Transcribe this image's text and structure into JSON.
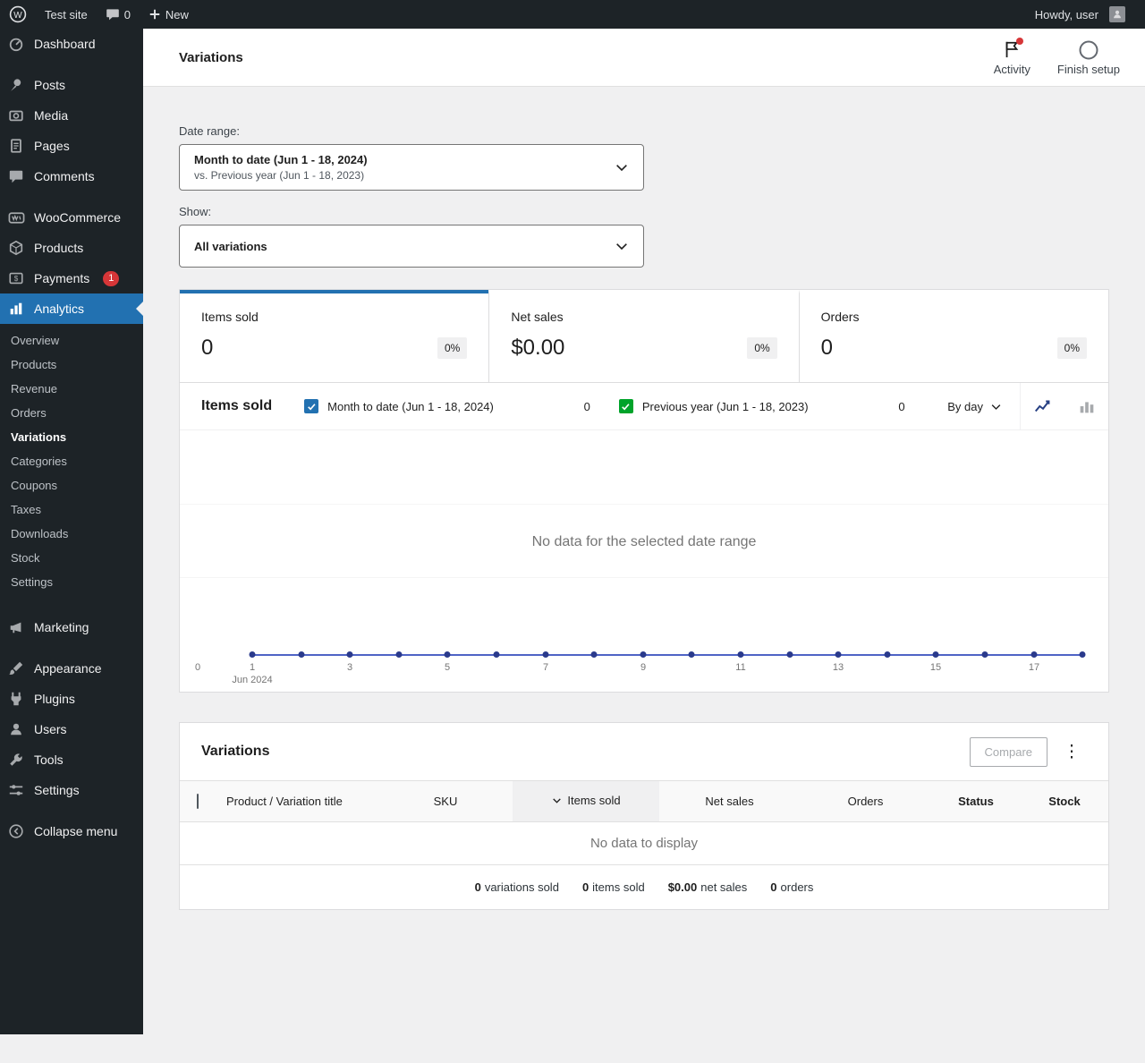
{
  "colors": {
    "accent": "#2271b1",
    "primary_series": "#2271b1",
    "secondary_series": "#00a32a",
    "chart_line": "#4f64c5",
    "chart_dot": "#2a3a8c",
    "badge_red": "#d63638"
  },
  "admin_bar": {
    "site_name": "Test site",
    "comments_count": "0",
    "new_label": "New",
    "howdy": "Howdy, user"
  },
  "sidebar": {
    "items": [
      {
        "label": "Dashboard"
      },
      {
        "label": "Posts"
      },
      {
        "label": "Media"
      },
      {
        "label": "Pages"
      },
      {
        "label": "Comments"
      },
      {
        "label": "WooCommerce"
      },
      {
        "label": "Products"
      },
      {
        "label": "Payments",
        "badge": "1"
      },
      {
        "label": "Analytics"
      },
      {
        "label": "Marketing"
      },
      {
        "label": "Appearance"
      },
      {
        "label": "Plugins"
      },
      {
        "label": "Users"
      },
      {
        "label": "Tools"
      },
      {
        "label": "Settings"
      },
      {
        "label": "Collapse menu"
      }
    ],
    "analytics_submenu": [
      {
        "label": "Overview"
      },
      {
        "label": "Products"
      },
      {
        "label": "Revenue"
      },
      {
        "label": "Orders"
      },
      {
        "label": "Variations"
      },
      {
        "label": "Categories"
      },
      {
        "label": "Coupons"
      },
      {
        "label": "Taxes"
      },
      {
        "label": "Downloads"
      },
      {
        "label": "Stock"
      },
      {
        "label": "Settings"
      }
    ]
  },
  "header": {
    "title": "Variations",
    "activity_label": "Activity",
    "finish_setup_label": "Finish setup"
  },
  "filters": {
    "date_range_label": "Date range:",
    "date_range_value": "Month to date (Jun 1 - 18, 2024)",
    "date_range_compare": "vs. Previous year (Jun 1 - 18, 2023)",
    "show_label": "Show:",
    "show_value": "All variations"
  },
  "stats": {
    "items_sold": {
      "label": "Items sold",
      "value": "0",
      "delta": "0%"
    },
    "net_sales": {
      "label": "Net sales",
      "value": "$0.00",
      "delta": "0%"
    },
    "orders": {
      "label": "Orders",
      "value": "0",
      "delta": "0%"
    }
  },
  "chart": {
    "title": "Items sold",
    "legend_primary_label": "Month to date (Jun 1 - 18, 2024)",
    "legend_primary_value": "0",
    "legend_secondary_label": "Previous year (Jun 1 - 18, 2023)",
    "legend_secondary_value": "0",
    "interval": "By day",
    "empty_message": "No data for the selected date range",
    "y_zero_label": "0",
    "x_ticks": [
      "1",
      "3",
      "5",
      "7",
      "9",
      "11",
      "13",
      "15",
      "17"
    ],
    "x_month_label": "Jun 2024"
  },
  "chart_data": {
    "type": "line",
    "title": "Items sold",
    "x": [
      1,
      2,
      3,
      4,
      5,
      6,
      7,
      8,
      9,
      10,
      11,
      12,
      13,
      14,
      15,
      16,
      17,
      18
    ],
    "series": [
      {
        "name": "Month to date (Jun 1 - 18, 2024)",
        "values": [
          0,
          0,
          0,
          0,
          0,
          0,
          0,
          0,
          0,
          0,
          0,
          0,
          0,
          0,
          0,
          0,
          0,
          0
        ]
      },
      {
        "name": "Previous year (Jun 1 - 18, 2023)",
        "values": [
          0,
          0,
          0,
          0,
          0,
          0,
          0,
          0,
          0,
          0,
          0,
          0,
          0,
          0,
          0,
          0,
          0,
          0
        ]
      }
    ],
    "xlabel": "Jun 2024",
    "ylim": [
      0,
      1
    ],
    "legend_position": "top",
    "grid": false
  },
  "table": {
    "title": "Variations",
    "compare_label": "Compare",
    "columns": [
      "Product / Variation title",
      "SKU",
      "Items sold",
      "Net sales",
      "Orders",
      "Status",
      "Stock"
    ],
    "sorted_column": "Items sold",
    "empty_message": "No data to display",
    "summary": [
      {
        "value": "0",
        "label": "variations sold"
      },
      {
        "value": "0",
        "label": "items sold"
      },
      {
        "value": "$0.00",
        "label": "net sales"
      },
      {
        "value": "0",
        "label": "orders"
      }
    ]
  }
}
